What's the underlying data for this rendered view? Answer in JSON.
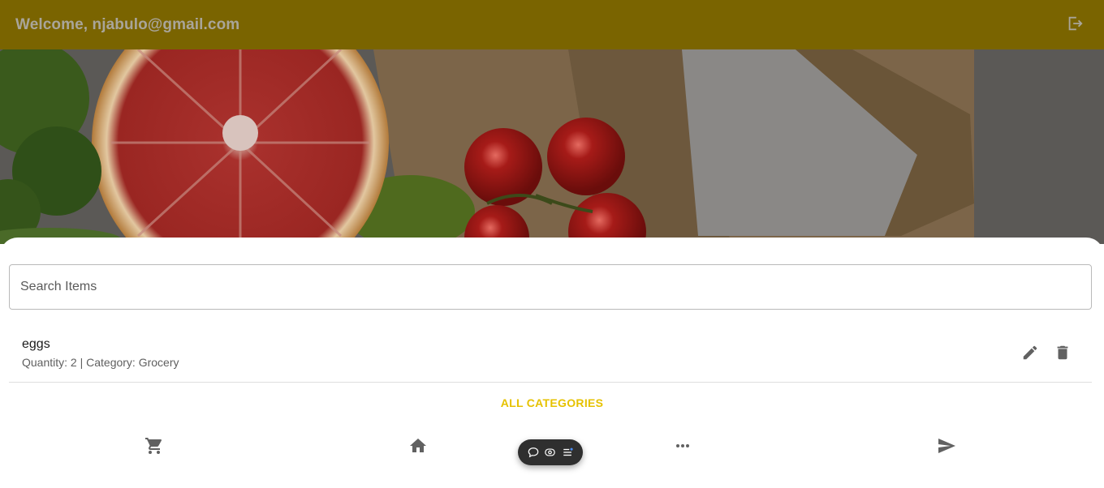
{
  "header": {
    "title": "Welcome, njabulo@gmail.com",
    "logout_icon": "logout-icon",
    "background_color": "#7a6400"
  },
  "hero": {
    "image": "groceries-banner (grapefruit, broccoli, cherry tomatoes, paper bag)"
  },
  "search": {
    "placeholder": "Search Items",
    "value": ""
  },
  "items": [
    {
      "name": "eggs",
      "quantity_label": "Quantity: 2",
      "separator": " | ",
      "category_label": "Category: Grocery",
      "actions": [
        "edit-icon",
        "delete-icon"
      ]
    }
  ],
  "filter": {
    "label": "ALL CATEGORIES",
    "color": "#e6c200"
  },
  "bottom_nav": [
    {
      "name": "cart",
      "icon": "cart-icon"
    },
    {
      "name": "home",
      "icon": "home-icon"
    },
    {
      "name": "more",
      "icon": "more-icon"
    },
    {
      "name": "send",
      "icon": "send-icon"
    }
  ],
  "floating_toolbar": {
    "icons": [
      "chat-bubble-icon",
      "eye-toggle-icon",
      "list-icon"
    ]
  }
}
